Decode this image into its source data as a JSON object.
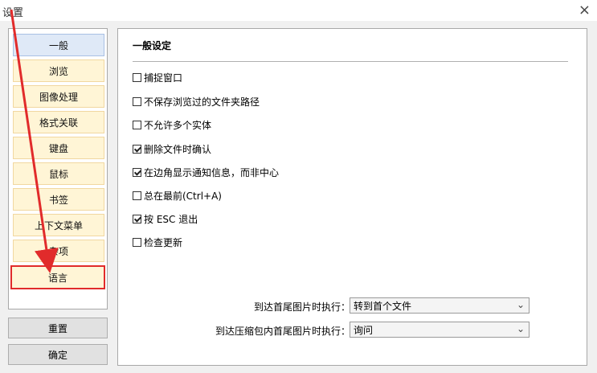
{
  "window": {
    "title": "设置",
    "close_symbol": "×"
  },
  "sidebar": {
    "items": [
      {
        "label": "一般"
      },
      {
        "label": "浏览"
      },
      {
        "label": "图像处理"
      },
      {
        "label": "格式关联"
      },
      {
        "label": "键盘"
      },
      {
        "label": "鼠标"
      },
      {
        "label": "书签"
      },
      {
        "label": "上下文菜单"
      },
      {
        "label": "杂项"
      },
      {
        "label": "语言"
      }
    ]
  },
  "buttons": {
    "reset": "重置",
    "ok": "确定"
  },
  "main": {
    "section_title": "一般设定",
    "options": [
      {
        "label": "捕捉窗口",
        "checked": false
      },
      {
        "label": "不保存浏览过的文件夹路径",
        "checked": false
      },
      {
        "label": "不允许多个实体",
        "checked": false
      },
      {
        "label": "删除文件时确认",
        "checked": true
      },
      {
        "label": "在边角显示通知信息，而非中心",
        "checked": true
      },
      {
        "label": "总在最前(Ctrl+A)",
        "checked": false
      },
      {
        "label": "按 ESC 退出",
        "checked": true
      },
      {
        "label": "检查更新",
        "checked": false
      }
    ],
    "end_image_label": "到达首尾图片时执行：",
    "end_image_value": "转到首个文件",
    "archive_end_label": "到达压缩包内首尾图片时执行：",
    "archive_end_value": "询问"
  },
  "colors": {
    "nav_item_bg": "#fff5d6",
    "nav_selected_bg": "#dfe9f7",
    "annotation_red": "#e12b2b"
  }
}
